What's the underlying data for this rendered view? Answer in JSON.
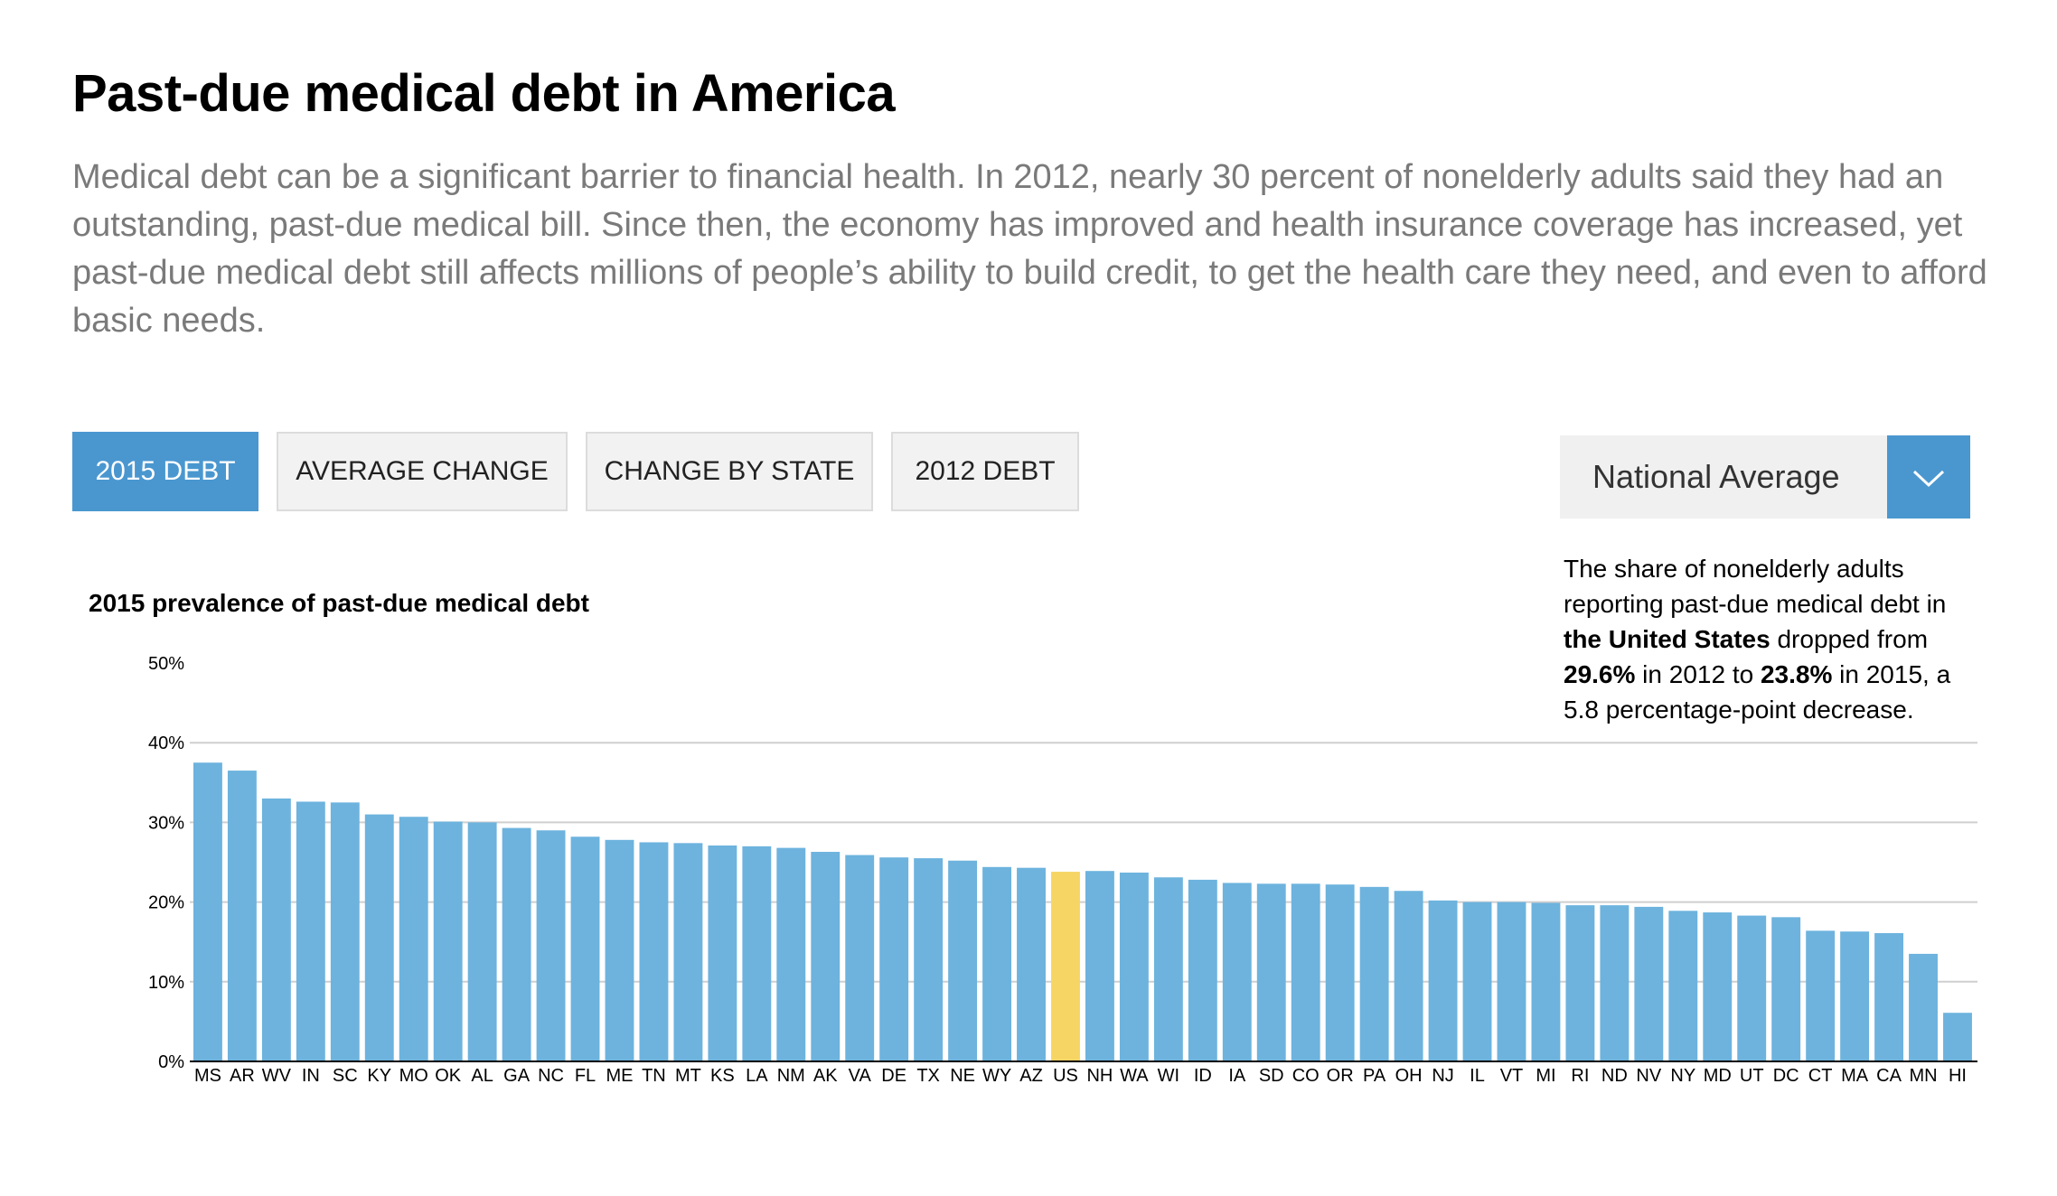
{
  "header": {
    "title": "Past-due medical debt in America",
    "intro": "Medical debt can be a significant barrier to financial health. In 2012, nearly 30 percent of nonelderly adults said they had an outstanding, past-due medical bill. Since then, the economy has improved and health insurance coverage has increased, yet past-due medical debt still affects millions of people’s ability to build credit, to get the health care they need, and even to afford basic needs."
  },
  "tabs": [
    {
      "label": "2015 DEBT",
      "active": true
    },
    {
      "label": "AVERAGE CHANGE",
      "active": false
    },
    {
      "label": "CHANGE BY STATE",
      "active": false
    },
    {
      "label": "2012 DEBT",
      "active": false
    }
  ],
  "selector": {
    "value": "National Average",
    "icon": "chevron-down-icon"
  },
  "note": {
    "part1": "The share of nonelderly adults reporting past-due medical debt in ",
    "place": "the United States",
    "part2": " dropped from ",
    "value_2012": "29.6%",
    "part3": " in 2012 to ",
    "value_2015": "23.8%",
    "part4": " in 2015, a 5.8 percentage-point decrease."
  },
  "colors": {
    "bar": "#6db3de",
    "highlight": "#f6d564",
    "active_tab": "#4a97d0"
  },
  "chart_data": {
    "type": "bar",
    "title": "2015 prevalence of past-due medical debt",
    "ylim": [
      0,
      50
    ],
    "yticks": [
      "0%",
      "10%",
      "20%",
      "30%",
      "40%",
      "50%"
    ],
    "grid": true,
    "highlight_category": "US",
    "categories": [
      "MS",
      "AR",
      "WV",
      "IN",
      "SC",
      "KY",
      "MO",
      "OK",
      "AL",
      "GA",
      "NC",
      "FL",
      "ME",
      "TN",
      "MT",
      "KS",
      "LA",
      "NM",
      "AK",
      "VA",
      "DE",
      "TX",
      "NE",
      "WY",
      "AZ",
      "US",
      "NH",
      "WA",
      "WI",
      "ID",
      "IA",
      "SD",
      "CO",
      "OR",
      "PA",
      "OH",
      "NJ",
      "IL",
      "VT",
      "MI",
      "RI",
      "ND",
      "NV",
      "NY",
      "MD",
      "UT",
      "DC",
      "CT",
      "MA",
      "CA",
      "MN",
      "HI"
    ],
    "values": [
      37.5,
      36.5,
      33.0,
      32.6,
      32.5,
      31.0,
      30.7,
      30.1,
      30.0,
      29.3,
      29.0,
      28.2,
      27.8,
      27.5,
      27.4,
      27.1,
      27.0,
      26.8,
      26.3,
      25.9,
      25.6,
      25.5,
      25.2,
      24.4,
      24.3,
      23.8,
      23.9,
      23.7,
      23.1,
      22.8,
      22.4,
      22.3,
      22.3,
      22.2,
      21.9,
      21.4,
      20.2,
      20.0,
      20.0,
      19.9,
      19.6,
      19.6,
      19.4,
      18.9,
      18.7,
      18.3,
      18.1,
      16.4,
      16.3,
      16.1,
      13.5,
      6.1
    ]
  }
}
